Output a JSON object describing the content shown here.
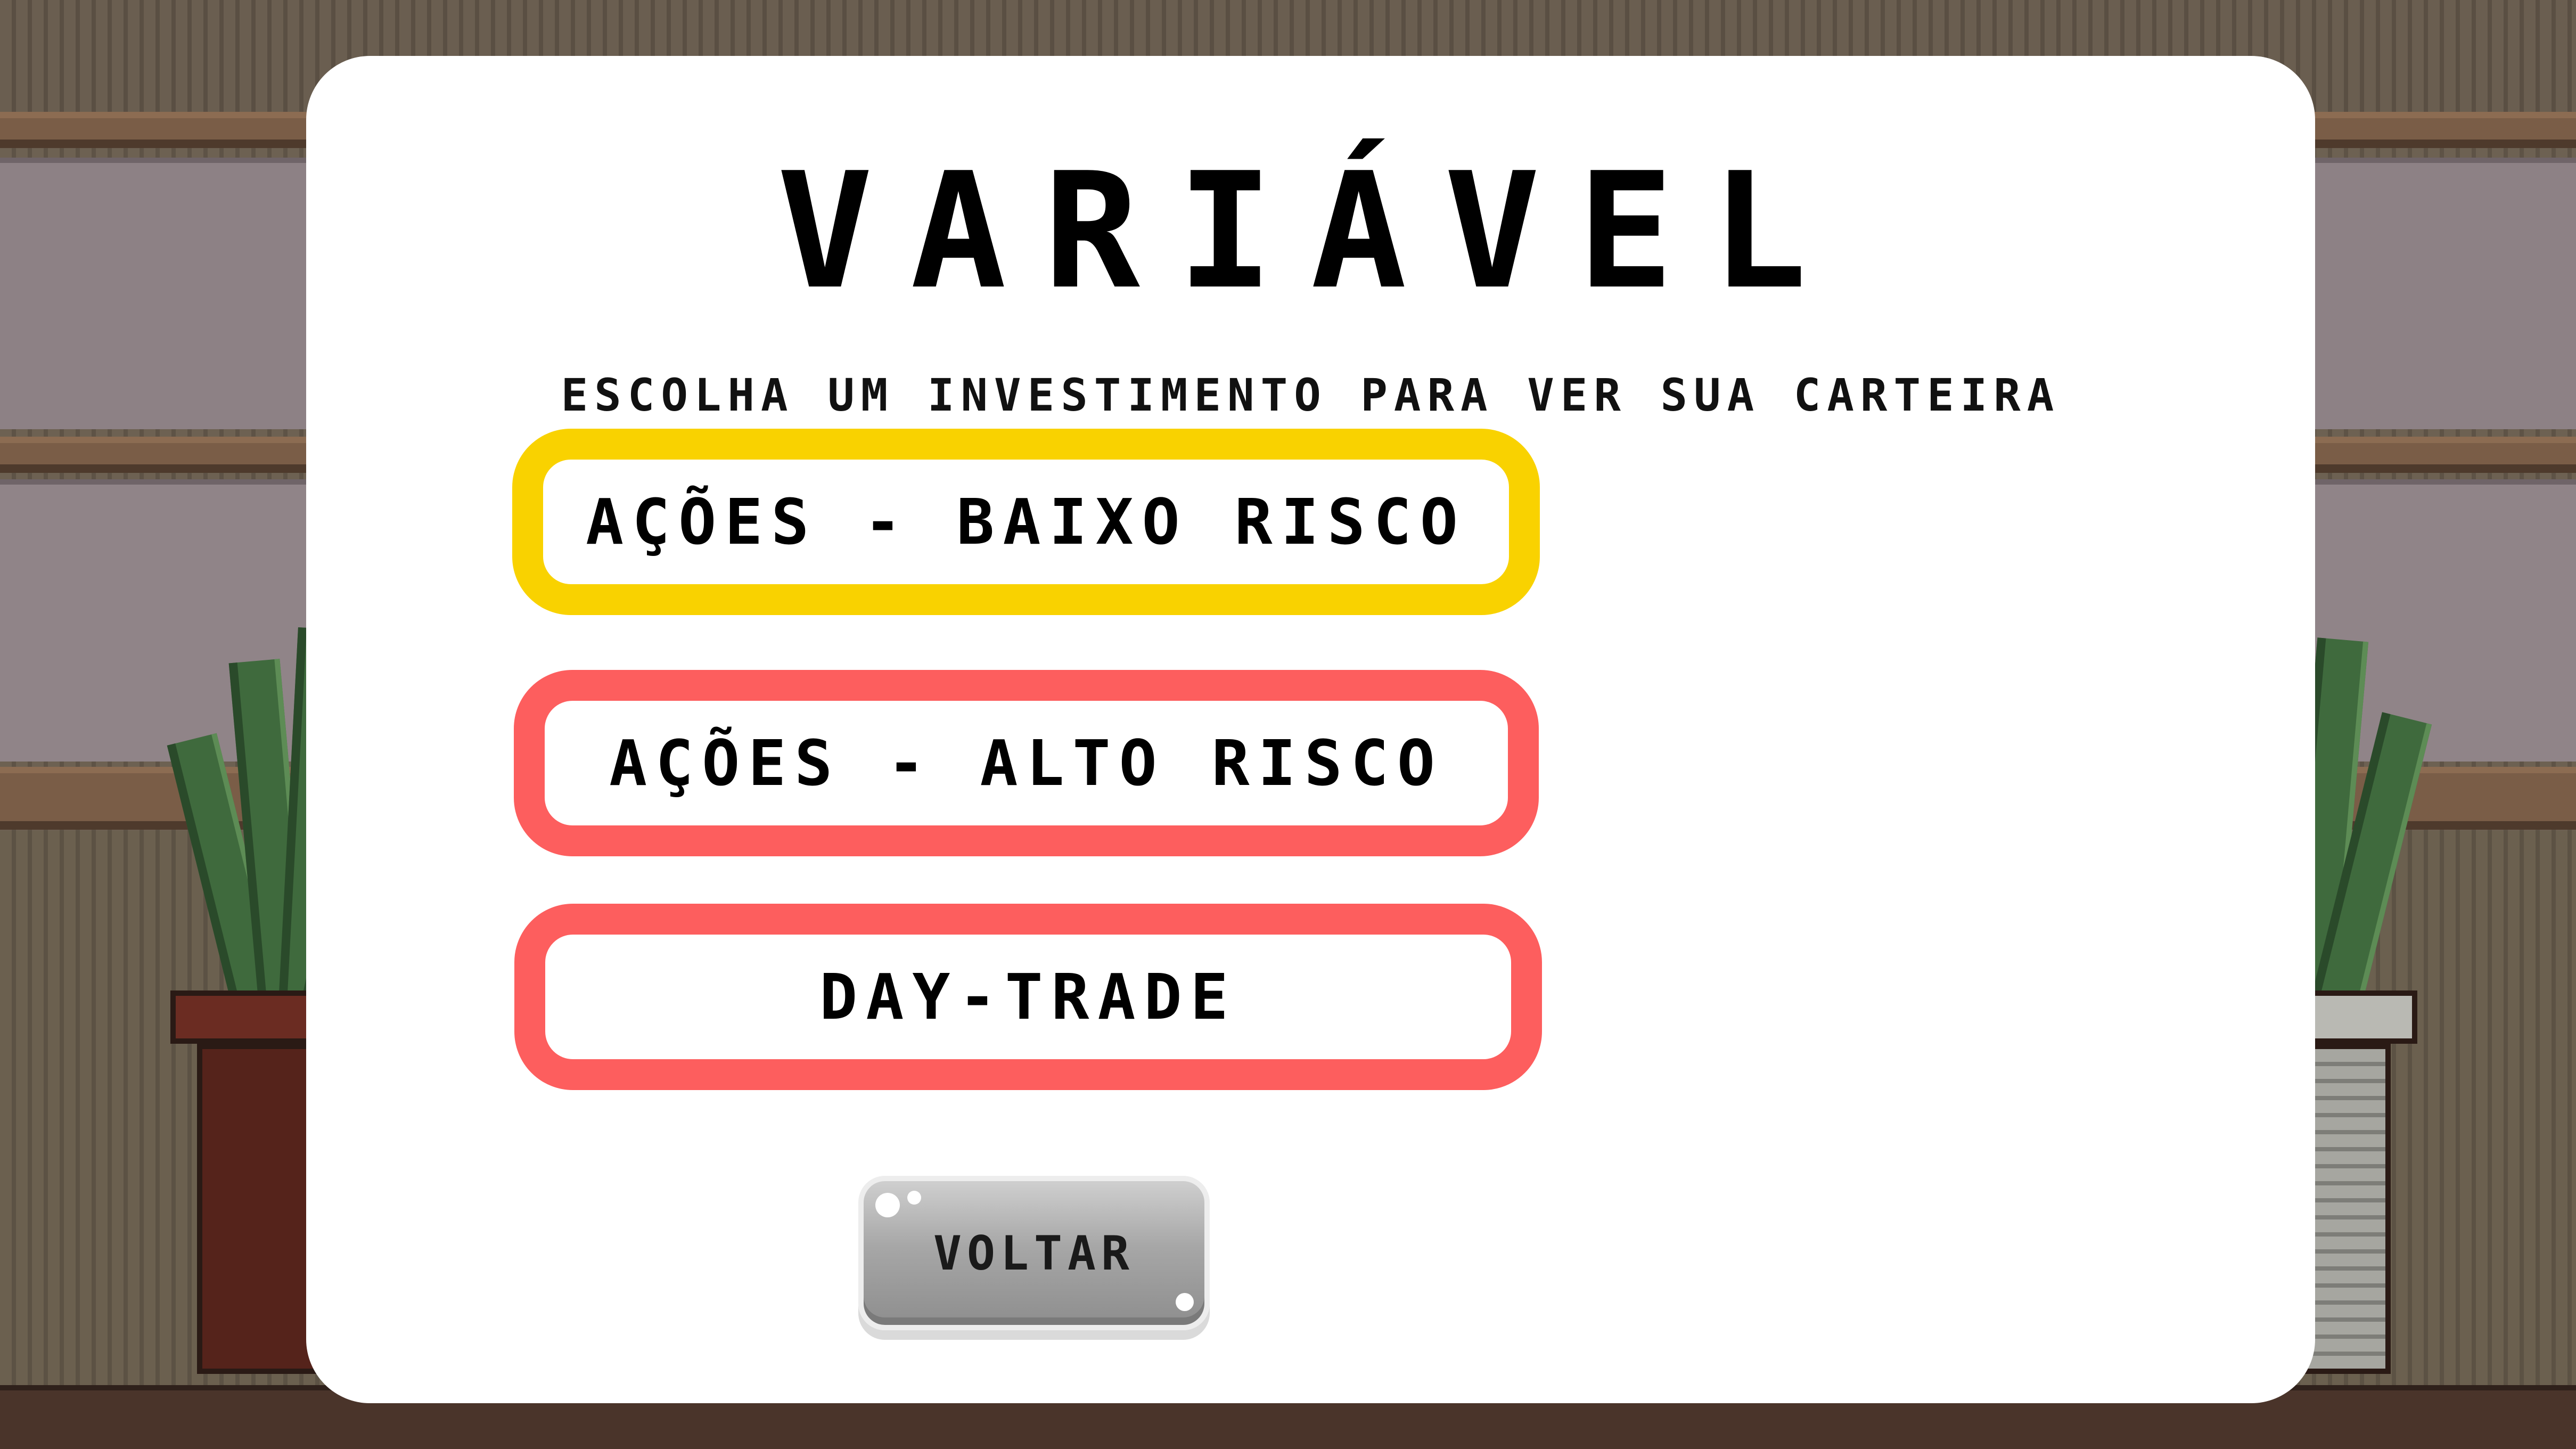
{
  "screen": {
    "title": "VARIÁVEL",
    "subtitle": "ESCOLHA UM INVESTIMENTO PARA VER SUA CARTEIRA"
  },
  "options": [
    {
      "label": "AÇÕES - BAIXO RISCO",
      "border_color": "#f9d200"
    },
    {
      "label": "AÇÕES - ALTO RISCO",
      "border_color": "#fd5e5e"
    },
    {
      "label": "DAY-TRADE",
      "border_color": "#fd5e5e"
    }
  ],
  "back_button": {
    "label": "VOLTAR"
  },
  "colors": {
    "modal_background": "#ffffff",
    "text": "#000000",
    "button_grey": "#a7a7a7"
  }
}
